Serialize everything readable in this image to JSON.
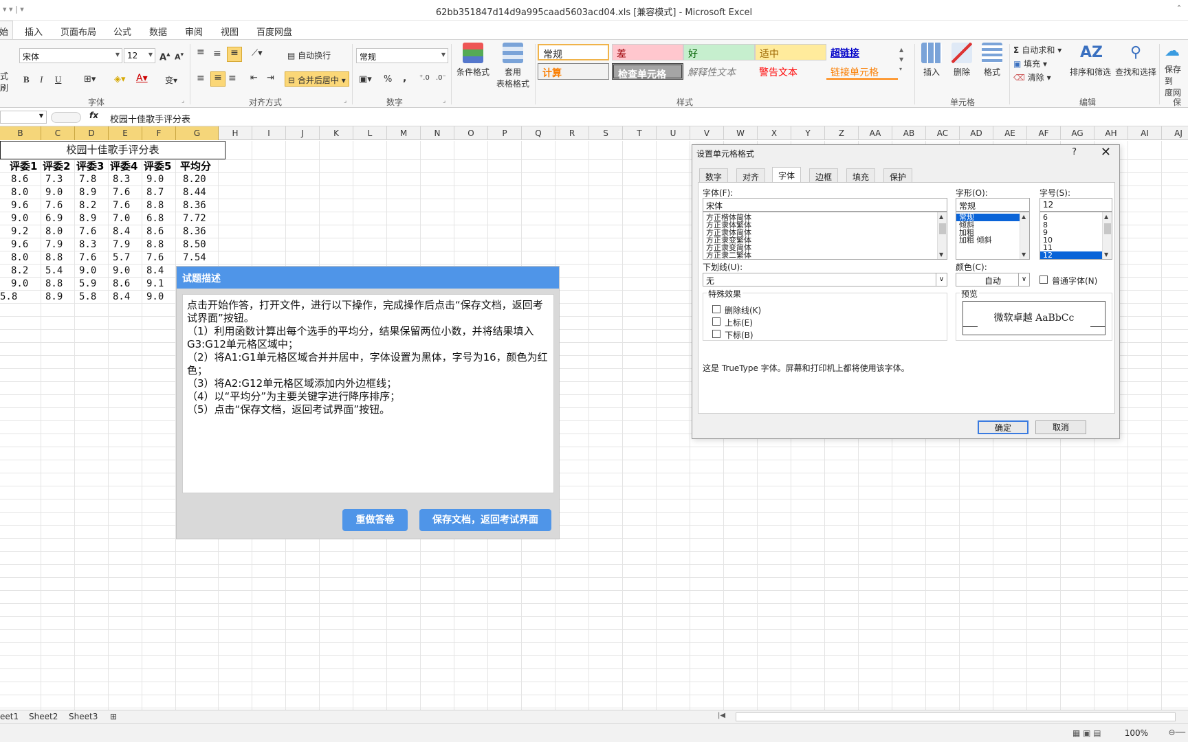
{
  "window": {
    "title": "62bb351847d14d9a995caad5603acd04.xls  [兼容模式] - Microsoft Excel"
  },
  "ribbon_tabs": [
    "始",
    "插入",
    "页面布局",
    "公式",
    "数据",
    "审阅",
    "视图",
    "百度网盘"
  ],
  "ribbon": {
    "font_name": "宋体",
    "font_size": "12",
    "bold": "B",
    "italic": "I",
    "underline": "U",
    "wrap_text": "自动换行",
    "merge_center": "合并后居中",
    "number_format": "常规",
    "percent": "%",
    "comma": ",",
    "conditional_format": "条件格式",
    "table_format_1": "套用",
    "table_format_2": "表格格式",
    "styles": {
      "normal": "常规",
      "bad": "差",
      "good": "好",
      "neutral": "适中",
      "hyperlink": "超链接",
      "calc": "计算",
      "check_cell": "检查单元格",
      "explanatory": "解释性文本",
      "warning": "警告文本",
      "linked_cell": "链接单元格"
    },
    "insert": "插入",
    "delete": "删除",
    "format": "格式",
    "autosum": "自动求和",
    "fill": "填充",
    "clear": "清除",
    "sort_filter": "排序和筛选",
    "find_select": "查找和选择",
    "save_to_1": "保存到",
    "save_to_2": "度网",
    "group_labels": {
      "font": "字体",
      "align": "对齐方式",
      "number": "数字",
      "styles": "样式",
      "cells": "单元格",
      "edit": "编辑",
      "save": "保存"
    },
    "clipboard_1": "式刷"
  },
  "formula_bar": {
    "fx": "fx",
    "value": "校园十佳歌手评分表"
  },
  "columns": [
    "B",
    "C",
    "D",
    "E",
    "F",
    "G",
    "H",
    "I",
    "J",
    "K",
    "L",
    "M",
    "N",
    "O",
    "P",
    "Q",
    "R",
    "S",
    "T",
    "U",
    "V",
    "W",
    "X",
    "Y",
    "Z",
    "AA",
    "AB",
    "AC",
    "AD",
    "AE",
    "AF",
    "AG",
    "AH",
    "AI",
    "AJ"
  ],
  "sheet": {
    "title": "校园十佳歌手评分表",
    "headers": [
      "评委1",
      "评委2",
      "评委3",
      "评委4",
      "评委5",
      "平均分"
    ],
    "rows": [
      [
        "8.6",
        "7.3",
        "7.8",
        "8.3",
        "9.0",
        "8.20"
      ],
      [
        "8.0",
        "9.0",
        "8.9",
        "7.6",
        "8.7",
        "8.44"
      ],
      [
        "9.6",
        "7.6",
        "8.2",
        "7.6",
        "8.8",
        "8.36"
      ],
      [
        "9.0",
        "6.9",
        "8.9",
        "7.0",
        "6.8",
        "7.72"
      ],
      [
        "9.2",
        "8.0",
        "7.6",
        "8.4",
        "8.6",
        "8.36"
      ],
      [
        "9.6",
        "7.9",
        "8.3",
        "7.9",
        "8.8",
        "8.50"
      ],
      [
        "8.0",
        "8.8",
        "7.6",
        "5.7",
        "7.6",
        "7.54"
      ],
      [
        "8.2",
        "5.4",
        "9.0",
        "9.0",
        "8.4",
        ""
      ],
      [
        "9.0",
        "8.8",
        "5.9",
        "8.6",
        "9.1",
        ""
      ],
      [
        "5.8",
        "8.9",
        "5.8",
        "8.4",
        "9.0",
        ""
      ]
    ]
  },
  "sheet_tabs": [
    "eet1",
    "Sheet2",
    "Sheet3"
  ],
  "status": {
    "zoom": "100%"
  },
  "task": {
    "title": "试题描述",
    "text": "点击开始作答，打开文件，进行以下操作，完成操作后点击“保存文档，返回考试界面”按钮。\n（1）利用函数计算出每个选手的平均分，结果保留两位小数，并将结果填入G3:G12单元格区域中；\n（2）将A1:G1单元格区域合并并居中，字体设置为黑体，字号为16，颜色为红色；\n（3）将A2:G12单元格区域添加内外边框线；\n（4）以“平均分”为主要关键字进行降序排序；\n（5）点击“保存文档，返回考试界面”按钮。",
    "redo_label": "重做答卷",
    "save_label": "保存文档，返回考试界面"
  },
  "dialog": {
    "title": "设置单元格格式",
    "help": "?",
    "close": "✕",
    "tabs": [
      "数字",
      "对齐",
      "字体",
      "边框",
      "填充",
      "保护"
    ],
    "font_label": "字体(F):",
    "font_value": "宋体",
    "font_list": [
      "方正楷体简体",
      "方正隶体繁体",
      "方正隶体简体",
      "方正隶变繁体",
      "方正隶变简体",
      "方正隶二繁体"
    ],
    "style_label": "字形(O):",
    "style_value": "常规",
    "style_list": [
      "常规",
      "倾斜",
      "加粗",
      "加粗 倾斜"
    ],
    "size_label": "字号(S):",
    "size_value": "12",
    "size_list": [
      "6",
      "8",
      "9",
      "10",
      "11",
      "12"
    ],
    "underline_label": "下划线(U):",
    "underline_value": "无",
    "color_label": "颜色(C):",
    "color_value": "自动",
    "normal_font_label": "普通字体(N)",
    "effects_label": "特殊效果",
    "strike_label": "删除线(K)",
    "super_label": "上标(E)",
    "sub_label": "下标(B)",
    "preview_label": "预览",
    "preview_text": "微软卓越  AaBbCc",
    "note": "这是 TrueType 字体。屏幕和打印机上都将使用该字体。",
    "ok": "确定",
    "cancel": "取消"
  },
  "colors": {
    "accent_blue": "#4f95e8",
    "selected_col": "#f5d67a",
    "dialog_sel": "#0a64d8"
  }
}
